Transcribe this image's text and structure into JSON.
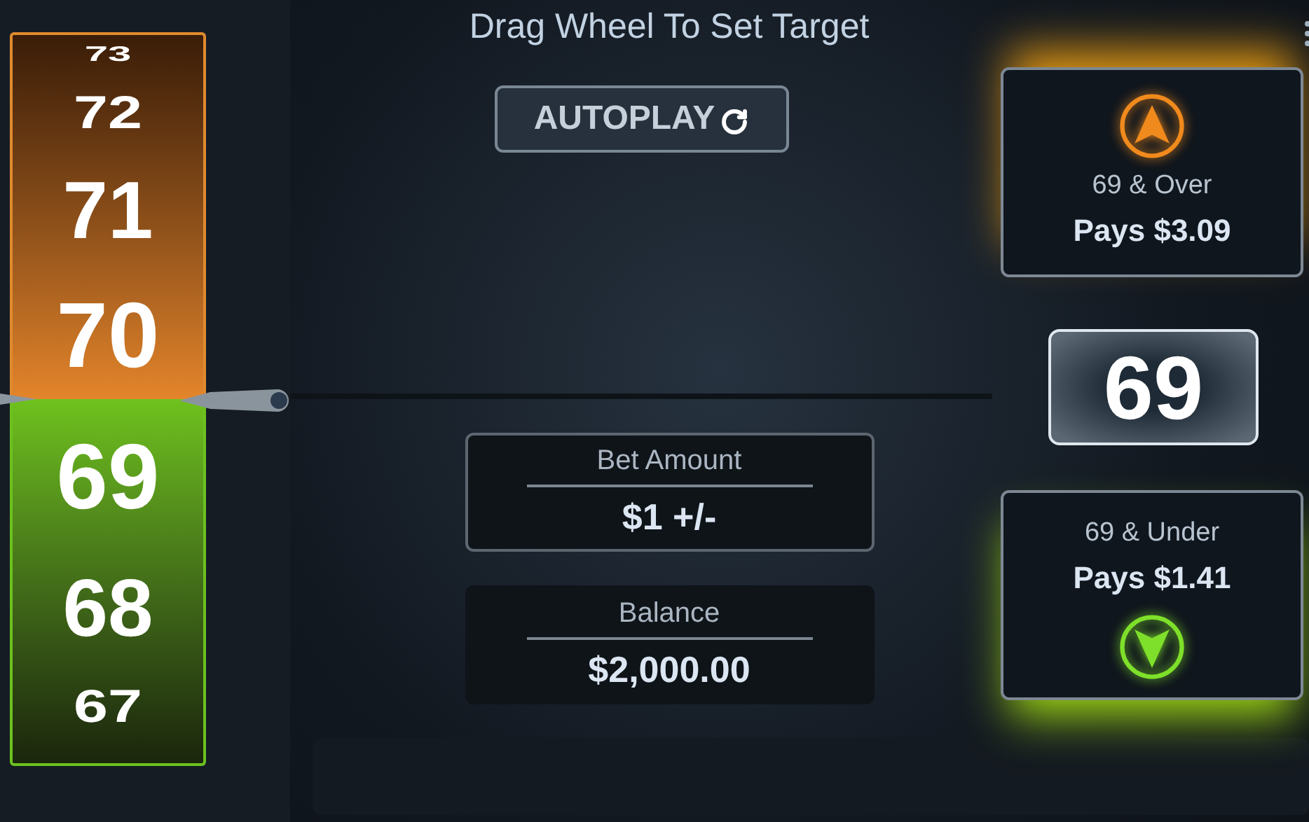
{
  "title": "Drag Wheel To Set Target",
  "autoplay": {
    "label": "AUTOPLAY"
  },
  "wheel": {
    "upper": [
      "73",
      "72",
      "71",
      "70"
    ],
    "lower": [
      "69",
      "68",
      "67"
    ]
  },
  "options": [
    {
      "kind": "over",
      "label": "69 & Over",
      "payout": "Pays $3.09"
    },
    {
      "kind": "under",
      "label": "69 & Under",
      "payout": "Pays $1.41"
    }
  ],
  "target": "69",
  "bets": [
    {
      "kind": "input",
      "label": "Bet Amount",
      "value": "$1 +/-"
    },
    {
      "kind": "display",
      "label": "Balance",
      "value": "$2,000.00"
    }
  ]
}
